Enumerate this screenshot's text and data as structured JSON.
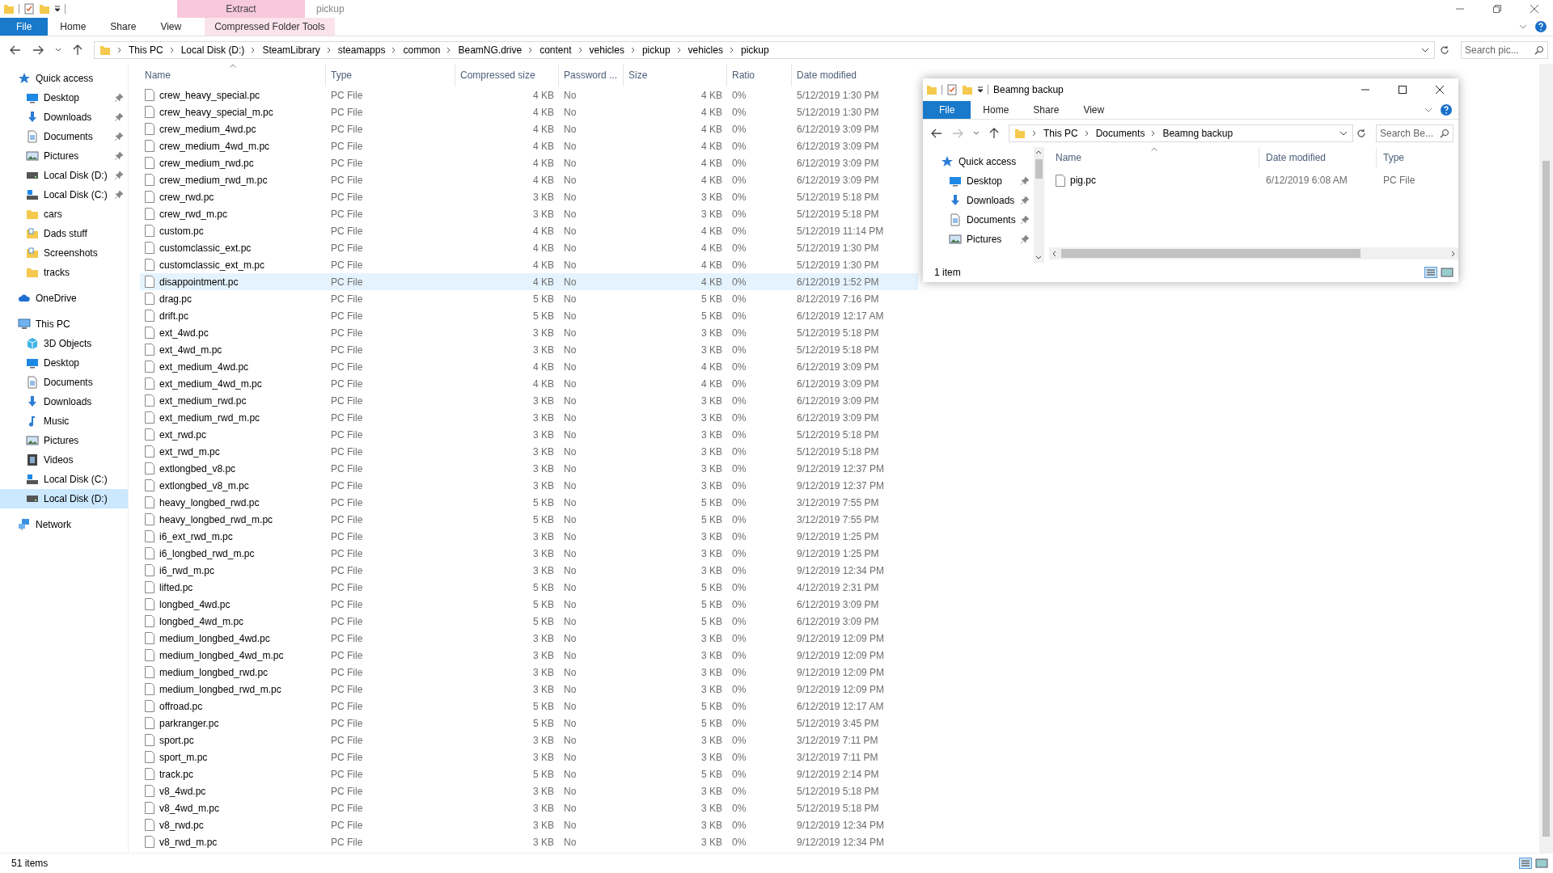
{
  "window": {
    "title": "pickup"
  },
  "ribbon": {
    "context_group": "Extract",
    "tabs": [
      {
        "label": "File",
        "kind": "file"
      },
      {
        "label": "Home",
        "kind": "tab"
      },
      {
        "label": "Share",
        "kind": "tab"
      },
      {
        "label": "View",
        "kind": "tab"
      },
      {
        "label": "Compressed Folder Tools",
        "kind": "contextual"
      }
    ]
  },
  "address_bar": {
    "breadcrumb": [
      "This PC",
      "Local Disk (D:)",
      "SteamLibrary",
      "steamapps",
      "common",
      "BeamNG.drive",
      "content",
      "vehicles",
      "pickup",
      "vehicles",
      "pickup"
    ],
    "search": {
      "placeholder": "Search pic..."
    }
  },
  "sidebar": {
    "items": [
      {
        "label": "Quick access",
        "kind": "star",
        "selected": false,
        "children": [
          {
            "label": "Desktop",
            "kind": "desktop",
            "pinned": true,
            "selected": false
          },
          {
            "label": "Downloads",
            "kind": "download",
            "pinned": true,
            "selected": false
          },
          {
            "label": "Documents",
            "kind": "document",
            "pinned": true,
            "selected": false
          },
          {
            "label": "Pictures",
            "kind": "pictures",
            "pinned": true,
            "selected": false
          },
          {
            "label": "Local Disk (D:)",
            "kind": "drive",
            "pinned": true,
            "selected": false
          },
          {
            "label": "Local Disk (C:)",
            "kind": "drive_c",
            "pinned": true,
            "selected": false
          },
          {
            "label": "cars",
            "kind": "folder",
            "pinned": false,
            "selected": false
          },
          {
            "label": "Dads stuff",
            "kind": "folder_doc",
            "pinned": false,
            "selected": false
          },
          {
            "label": "Screenshots",
            "kind": "folder_doc",
            "pinned": false,
            "selected": false
          },
          {
            "label": "tracks",
            "kind": "folder",
            "pinned": false,
            "selected": false
          }
        ]
      },
      {
        "label": "OneDrive",
        "kind": "cloud",
        "selected": false
      },
      {
        "label": "This PC",
        "kind": "pc",
        "selected": false,
        "children": [
          {
            "label": "3D Objects",
            "kind": "cube",
            "pinned": false,
            "selected": false
          },
          {
            "label": "Desktop",
            "kind": "desktop",
            "pinned": false,
            "selected": false
          },
          {
            "label": "Documents",
            "kind": "document",
            "pinned": false,
            "selected": false
          },
          {
            "label": "Downloads",
            "kind": "download",
            "pinned": false,
            "selected": false
          },
          {
            "label": "Music",
            "kind": "music",
            "pinned": false,
            "selected": false
          },
          {
            "label": "Pictures",
            "kind": "pictures",
            "pinned": false,
            "selected": false
          },
          {
            "label": "Videos",
            "kind": "video",
            "pinned": false,
            "selected": false
          },
          {
            "label": "Local Disk (C:)",
            "kind": "drive_c",
            "pinned": false,
            "selected": false
          },
          {
            "label": "Local Disk (D:)",
            "kind": "drive",
            "pinned": false,
            "selected": true
          }
        ]
      },
      {
        "label": "Network",
        "kind": "network",
        "selected": false
      }
    ]
  },
  "table": {
    "columns": [
      {
        "label": "Name",
        "sorted": true
      },
      {
        "label": "Type",
        "sorted": false
      },
      {
        "label": "Compressed size",
        "sorted": false
      },
      {
        "label": "Password ...",
        "sorted": false
      },
      {
        "label": "Size",
        "sorted": false
      },
      {
        "label": "Ratio",
        "sorted": false
      },
      {
        "label": "Date modified",
        "sorted": false
      }
    ],
    "rows": [
      {
        "name": "crew_heavy_special.pc",
        "type": "PC File",
        "compressed_size": "4 KB",
        "password": "No",
        "size": "4 KB",
        "ratio": "0%",
        "date_modified": "5/12/2019 1:30 PM",
        "selected": false
      },
      {
        "name": "crew_heavy_special_m.pc",
        "type": "PC File",
        "compressed_size": "4 KB",
        "password": "No",
        "size": "4 KB",
        "ratio": "0%",
        "date_modified": "5/12/2019 1:30 PM",
        "selected": false
      },
      {
        "name": "crew_medium_4wd.pc",
        "type": "PC File",
        "compressed_size": "4 KB",
        "password": "No",
        "size": "4 KB",
        "ratio": "0%",
        "date_modified": "6/12/2019 3:09 PM",
        "selected": false
      },
      {
        "name": "crew_medium_4wd_m.pc",
        "type": "PC File",
        "compressed_size": "4 KB",
        "password": "No",
        "size": "4 KB",
        "ratio": "0%",
        "date_modified": "6/12/2019 3:09 PM",
        "selected": false
      },
      {
        "name": "crew_medium_rwd.pc",
        "type": "PC File",
        "compressed_size": "4 KB",
        "password": "No",
        "size": "4 KB",
        "ratio": "0%",
        "date_modified": "6/12/2019 3:09 PM",
        "selected": false
      },
      {
        "name": "crew_medium_rwd_m.pc",
        "type": "PC File",
        "compressed_size": "4 KB",
        "password": "No",
        "size": "4 KB",
        "ratio": "0%",
        "date_modified": "6/12/2019 3:09 PM",
        "selected": false
      },
      {
        "name": "crew_rwd.pc",
        "type": "PC File",
        "compressed_size": "3 KB",
        "password": "No",
        "size": "3 KB",
        "ratio": "0%",
        "date_modified": "5/12/2019 5:18 PM",
        "selected": false
      },
      {
        "name": "crew_rwd_m.pc",
        "type": "PC File",
        "compressed_size": "3 KB",
        "password": "No",
        "size": "3 KB",
        "ratio": "0%",
        "date_modified": "5/12/2019 5:18 PM",
        "selected": false
      },
      {
        "name": "custom.pc",
        "type": "PC File",
        "compressed_size": "4 KB",
        "password": "No",
        "size": "4 KB",
        "ratio": "0%",
        "date_modified": "5/12/2019 11:14 PM",
        "selected": false
      },
      {
        "name": "customclassic_ext.pc",
        "type": "PC File",
        "compressed_size": "4 KB",
        "password": "No",
        "size": "4 KB",
        "ratio": "0%",
        "date_modified": "5/12/2019 1:30 PM",
        "selected": false
      },
      {
        "name": "customclassic_ext_m.pc",
        "type": "PC File",
        "compressed_size": "4 KB",
        "password": "No",
        "size": "4 KB",
        "ratio": "0%",
        "date_modified": "5/12/2019 1:30 PM",
        "selected": false
      },
      {
        "name": "disappointment.pc",
        "type": "PC File",
        "compressed_size": "4 KB",
        "password": "No",
        "size": "4 KB",
        "ratio": "0%",
        "date_modified": "6/12/2019 1:52 PM",
        "selected": true
      },
      {
        "name": "drag.pc",
        "type": "PC File",
        "compressed_size": "5 KB",
        "password": "No",
        "size": "5 KB",
        "ratio": "0%",
        "date_modified": "8/12/2019 7:16 PM",
        "selected": false
      },
      {
        "name": "drift.pc",
        "type": "PC File",
        "compressed_size": "5 KB",
        "password": "No",
        "size": "5 KB",
        "ratio": "0%",
        "date_modified": "6/12/2019 12:17 AM",
        "selected": false
      },
      {
        "name": "ext_4wd.pc",
        "type": "PC File",
        "compressed_size": "3 KB",
        "password": "No",
        "size": "3 KB",
        "ratio": "0%",
        "date_modified": "5/12/2019 5:18 PM",
        "selected": false
      },
      {
        "name": "ext_4wd_m.pc",
        "type": "PC File",
        "compressed_size": "3 KB",
        "password": "No",
        "size": "3 KB",
        "ratio": "0%",
        "date_modified": "5/12/2019 5:18 PM",
        "selected": false
      },
      {
        "name": "ext_medium_4wd.pc",
        "type": "PC File",
        "compressed_size": "4 KB",
        "password": "No",
        "size": "4 KB",
        "ratio": "0%",
        "date_modified": "6/12/2019 3:09 PM",
        "selected": false
      },
      {
        "name": "ext_medium_4wd_m.pc",
        "type": "PC File",
        "compressed_size": "4 KB",
        "password": "No",
        "size": "4 KB",
        "ratio": "0%",
        "date_modified": "6/12/2019 3:09 PM",
        "selected": false
      },
      {
        "name": "ext_medium_rwd.pc",
        "type": "PC File",
        "compressed_size": "3 KB",
        "password": "No",
        "size": "3 KB",
        "ratio": "0%",
        "date_modified": "6/12/2019 3:09 PM",
        "selected": false
      },
      {
        "name": "ext_medium_rwd_m.pc",
        "type": "PC File",
        "compressed_size": "3 KB",
        "password": "No",
        "size": "3 KB",
        "ratio": "0%",
        "date_modified": "6/12/2019 3:09 PM",
        "selected": false
      },
      {
        "name": "ext_rwd.pc",
        "type": "PC File",
        "compressed_size": "3 KB",
        "password": "No",
        "size": "3 KB",
        "ratio": "0%",
        "date_modified": "5/12/2019 5:18 PM",
        "selected": false
      },
      {
        "name": "ext_rwd_m.pc",
        "type": "PC File",
        "compressed_size": "3 KB",
        "password": "No",
        "size": "3 KB",
        "ratio": "0%",
        "date_modified": "5/12/2019 5:18 PM",
        "selected": false
      },
      {
        "name": "extlongbed_v8.pc",
        "type": "PC File",
        "compressed_size": "3 KB",
        "password": "No",
        "size": "3 KB",
        "ratio": "0%",
        "date_modified": "9/12/2019 12:37 PM",
        "selected": false
      },
      {
        "name": "extlongbed_v8_m.pc",
        "type": "PC File",
        "compressed_size": "3 KB",
        "password": "No",
        "size": "3 KB",
        "ratio": "0%",
        "date_modified": "9/12/2019 12:37 PM",
        "selected": false
      },
      {
        "name": "heavy_longbed_rwd.pc",
        "type": "PC File",
        "compressed_size": "5 KB",
        "password": "No",
        "size": "5 KB",
        "ratio": "0%",
        "date_modified": "3/12/2019 7:55 PM",
        "selected": false
      },
      {
        "name": "heavy_longbed_rwd_m.pc",
        "type": "PC File",
        "compressed_size": "5 KB",
        "password": "No",
        "size": "5 KB",
        "ratio": "0%",
        "date_modified": "3/12/2019 7:55 PM",
        "selected": false
      },
      {
        "name": "i6_ext_rwd_m.pc",
        "type": "PC File",
        "compressed_size": "3 KB",
        "password": "No",
        "size": "3 KB",
        "ratio": "0%",
        "date_modified": "9/12/2019 1:25 PM",
        "selected": false
      },
      {
        "name": "i6_longbed_rwd_m.pc",
        "type": "PC File",
        "compressed_size": "3 KB",
        "password": "No",
        "size": "3 KB",
        "ratio": "0%",
        "date_modified": "9/12/2019 1:25 PM",
        "selected": false
      },
      {
        "name": "i6_rwd_m.pc",
        "type": "PC File",
        "compressed_size": "3 KB",
        "password": "No",
        "size": "3 KB",
        "ratio": "0%",
        "date_modified": "9/12/2019 12:34 PM",
        "selected": false
      },
      {
        "name": "lifted.pc",
        "type": "PC File",
        "compressed_size": "5 KB",
        "password": "No",
        "size": "5 KB",
        "ratio": "0%",
        "date_modified": "4/12/2019 2:31 PM",
        "selected": false
      },
      {
        "name": "longbed_4wd.pc",
        "type": "PC File",
        "compressed_size": "5 KB",
        "password": "No",
        "size": "5 KB",
        "ratio": "0%",
        "date_modified": "6/12/2019 3:09 PM",
        "selected": false
      },
      {
        "name": "longbed_4wd_m.pc",
        "type": "PC File",
        "compressed_size": "5 KB",
        "password": "No",
        "size": "5 KB",
        "ratio": "0%",
        "date_modified": "6/12/2019 3:09 PM",
        "selected": false
      },
      {
        "name": "medium_longbed_4wd.pc",
        "type": "PC File",
        "compressed_size": "3 KB",
        "password": "No",
        "size": "3 KB",
        "ratio": "0%",
        "date_modified": "9/12/2019 12:09 PM",
        "selected": false
      },
      {
        "name": "medium_longbed_4wd_m.pc",
        "type": "PC File",
        "compressed_size": "3 KB",
        "password": "No",
        "size": "3 KB",
        "ratio": "0%",
        "date_modified": "9/12/2019 12:09 PM",
        "selected": false
      },
      {
        "name": "medium_longbed_rwd.pc",
        "type": "PC File",
        "compressed_size": "3 KB",
        "password": "No",
        "size": "3 KB",
        "ratio": "0%",
        "date_modified": "9/12/2019 12:09 PM",
        "selected": false
      },
      {
        "name": "medium_longbed_rwd_m.pc",
        "type": "PC File",
        "compressed_size": "3 KB",
        "password": "No",
        "size": "3 KB",
        "ratio": "0%",
        "date_modified": "9/12/2019 12:09 PM",
        "selected": false
      },
      {
        "name": "offroad.pc",
        "type": "PC File",
        "compressed_size": "5 KB",
        "password": "No",
        "size": "5 KB",
        "ratio": "0%",
        "date_modified": "6/12/2019 12:17 AM",
        "selected": false
      },
      {
        "name": "parkranger.pc",
        "type": "PC File",
        "compressed_size": "5 KB",
        "password": "No",
        "size": "5 KB",
        "ratio": "0%",
        "date_modified": "5/12/2019 3:45 PM",
        "selected": false
      },
      {
        "name": "sport.pc",
        "type": "PC File",
        "compressed_size": "3 KB",
        "password": "No",
        "size": "3 KB",
        "ratio": "0%",
        "date_modified": "3/12/2019 7:11 PM",
        "selected": false
      },
      {
        "name": "sport_m.pc",
        "type": "PC File",
        "compressed_size": "3 KB",
        "password": "No",
        "size": "3 KB",
        "ratio": "0%",
        "date_modified": "3/12/2019 7:11 PM",
        "selected": false
      },
      {
        "name": "track.pc",
        "type": "PC File",
        "compressed_size": "5 KB",
        "password": "No",
        "size": "5 KB",
        "ratio": "0%",
        "date_modified": "9/12/2019 2:14 PM",
        "selected": false
      },
      {
        "name": "v8_4wd.pc",
        "type": "PC File",
        "compressed_size": "3 KB",
        "password": "No",
        "size": "3 KB",
        "ratio": "0%",
        "date_modified": "5/12/2019 5:18 PM",
        "selected": false
      },
      {
        "name": "v8_4wd_m.pc",
        "type": "PC File",
        "compressed_size": "3 KB",
        "password": "No",
        "size": "3 KB",
        "ratio": "0%",
        "date_modified": "5/12/2019 5:18 PM",
        "selected": false
      },
      {
        "name": "v8_rwd.pc",
        "type": "PC File",
        "compressed_size": "3 KB",
        "password": "No",
        "size": "3 KB",
        "ratio": "0%",
        "date_modified": "9/12/2019 12:34 PM",
        "selected": false
      },
      {
        "name": "v8_rwd_m.pc",
        "type": "PC File",
        "compressed_size": "3 KB",
        "password": "No",
        "size": "3 KB",
        "ratio": "0%",
        "date_modified": "9/12/2019 12:34 PM",
        "selected": false
      }
    ]
  },
  "status_bar": {
    "item_count": "51 items"
  },
  "second_window": {
    "title": "Beamng backup",
    "tabs": [
      {
        "label": "File",
        "kind": "file"
      },
      {
        "label": "Home",
        "kind": "tab"
      },
      {
        "label": "Share",
        "kind": "tab"
      },
      {
        "label": "View",
        "kind": "tab"
      }
    ],
    "breadcrumb": [
      "This PC",
      "Documents",
      "Beamng backup"
    ],
    "search": {
      "placeholder": "Search Be..."
    },
    "sidebar": {
      "items": [
        {
          "label": "Quick access",
          "kind": "star",
          "selected": false,
          "children": [
            {
              "label": "Desktop",
              "kind": "desktop",
              "pinned": true,
              "selected": false
            },
            {
              "label": "Downloads",
              "kind": "download",
              "pinned": true,
              "selected": false
            },
            {
              "label": "Documents",
              "kind": "document",
              "pinned": true,
              "selected": false
            },
            {
              "label": "Pictures",
              "kind": "pictures",
              "pinned": true,
              "selected": false
            }
          ]
        }
      ]
    },
    "columns": [
      {
        "label": "Name",
        "sorted": true
      },
      {
        "label": "Date modified",
        "sorted": false
      },
      {
        "label": "Type",
        "sorted": false
      }
    ],
    "rows": [
      {
        "name": "pig.pc",
        "date_modified": "6/12/2019 6:08 AM",
        "type": "PC File",
        "selected": false
      }
    ],
    "status_bar": {
      "item_count": "1 item"
    }
  }
}
